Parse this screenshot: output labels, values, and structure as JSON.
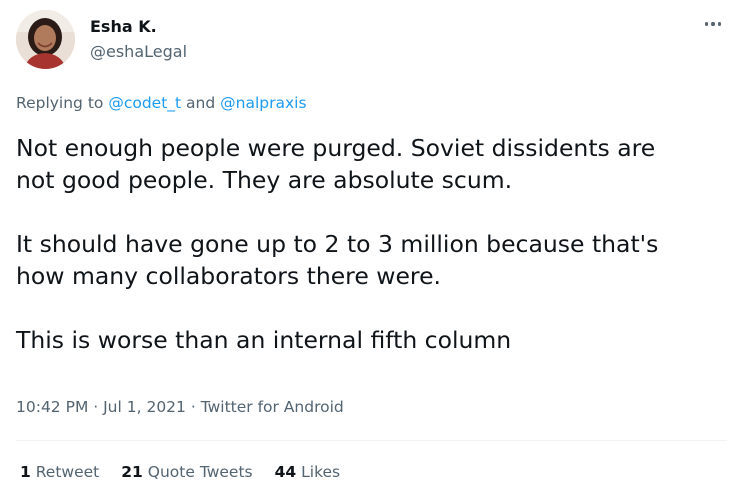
{
  "author": {
    "display_name": "Esha K.",
    "handle": "@eshaLegal"
  },
  "reply": {
    "prefix": "Replying to ",
    "mention_1": "@codet_t",
    "joiner": " and ",
    "mention_2": "@nalpraxis"
  },
  "body": {
    "line_1": "Not enough people were purged. Soviet dissidents are",
    "line_2": "not good people. They are absolute scum.",
    "line_3": "It should have gone up to 2 to 3 million because that's",
    "line_4": "how many collaborators there were.",
    "line_5": "This is worse than an internal fifth column"
  },
  "meta": {
    "time": "10:42 PM",
    "sep": " · ",
    "date": "Jul 1, 2021",
    "source": "Twitter for Android"
  },
  "stats": {
    "retweets_count": "1",
    "retweets_label": "Retweet",
    "quotes_count": "21",
    "quotes_label": "Quote Tweets",
    "likes_count": "44",
    "likes_label": "Likes"
  },
  "icons": {
    "more": "more-horizontal-icon"
  },
  "colors": {
    "text": "#0f1419",
    "secondary": "#536471",
    "link": "#1d9bf0",
    "divider": "#eff3f4"
  }
}
